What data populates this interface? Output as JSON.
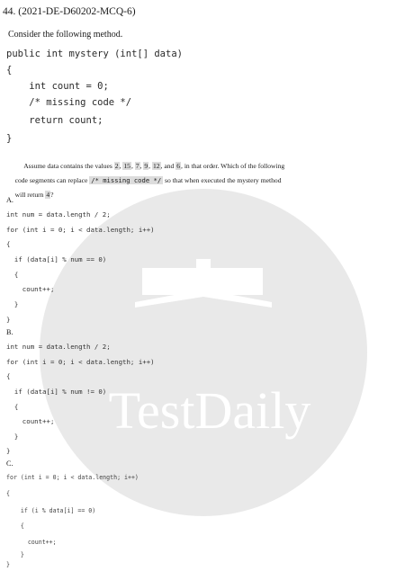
{
  "question_header": "44. (2021-DE-D60202-MCQ-6)",
  "intro": "Consider the following method.",
  "method_code": [
    "public int mystery (int[] data)",
    "{",
    "    int count = 0;",
    "    /* missing code */",
    "    return count;",
    "}"
  ],
  "prompt": {
    "line1_a": "Assume data contains the values ",
    "values": [
      "2",
      "15",
      "7",
      "9",
      "12",
      "6"
    ],
    "line1_b": ", and ",
    "line1_c": ", in that order. Which of the following",
    "line2_a": "code segments can replace ",
    "code_ref": "/* missing code */",
    "line2_b": " so that when executed the mystery method",
    "line3_a": "will return ",
    "return_value": "4",
    "line3_b": "?"
  },
  "options": [
    {
      "label": "A.",
      "lines": [
        "int num = data.length / 2;",
        "for (int i = 0; i < data.length; i++)",
        "{",
        "  if (data[i] % num == 0)",
        "  {",
        "    count++;",
        "  }",
        "}"
      ]
    },
    {
      "label": "B.",
      "lines": [
        "int num = data.length / 2;",
        "for (int i = 0; i < data.length; i++)",
        "{",
        "  if (data[i] % num != 0)",
        "  {",
        "    count++;",
        "  }",
        "}"
      ]
    },
    {
      "label": "C.",
      "lines": [
        "for (int i = 0; i < data.length; i++)",
        "{",
        "    if (i % data[i] == 0)",
        "    {",
        "      count++;",
        "    }",
        "}"
      ]
    }
  ],
  "watermark": {
    "text": "TestDaily",
    "color": "#e9e9e9"
  }
}
